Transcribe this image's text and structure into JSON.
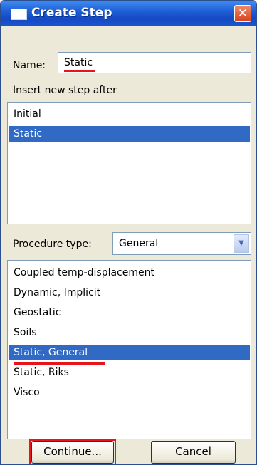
{
  "window": {
    "title": "Create Step"
  },
  "name_field": {
    "label": "Name:",
    "value": "Static"
  },
  "insert_after": {
    "label": "Insert new step after",
    "steps": [
      "Initial",
      "Static"
    ],
    "selected": "Static"
  },
  "procedure": {
    "label": "Procedure type:",
    "selected_type": "General",
    "options": [
      "Coupled temp-displacement",
      "Dynamic, Implicit",
      "Geostatic",
      "Soils",
      "Static, General",
      "Static, Riks",
      "Visco"
    ],
    "selected": "Static, General"
  },
  "buttons": {
    "continue_label": "Continue...",
    "cancel_label": "Cancel"
  },
  "colors": {
    "selection": "#316ac5",
    "highlight": "#e8131b",
    "titlebar": "#1f5fd6"
  }
}
